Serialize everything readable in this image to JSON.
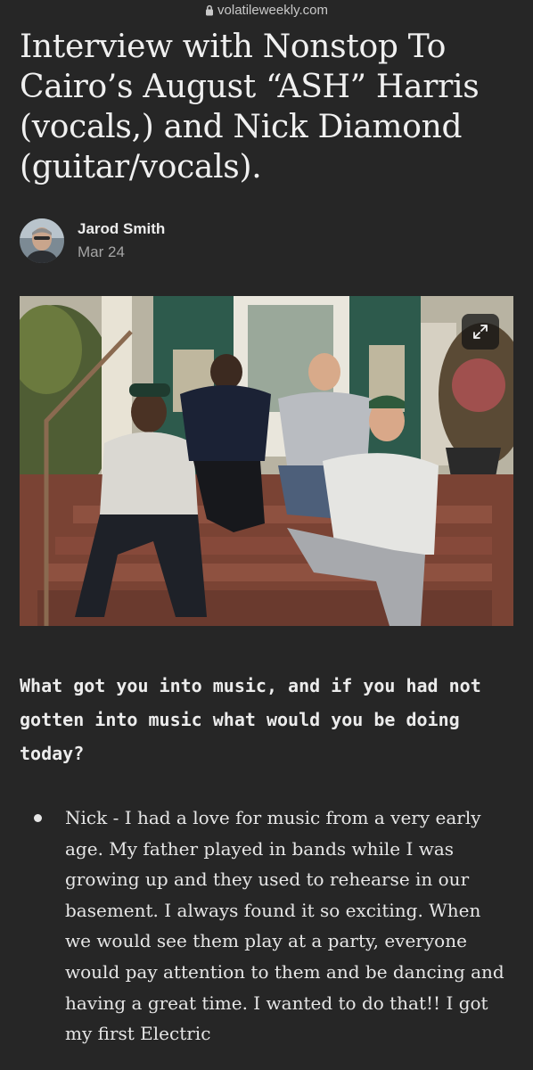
{
  "browser": {
    "url": "volatileweekly.com",
    "lock_icon": "lock-icon"
  },
  "article": {
    "title": "Interview with Nonstop To Cairo’s August “ASH” Harris (vocals,) and Nick Diamond (guitar/vocals).",
    "author": {
      "name": "Jarod Smith",
      "date": "Mar 24"
    },
    "hero_image": {
      "expand_icon": "expand-icon"
    },
    "question": "What got you into music, and if you had not gotten into music what would you be doing today?",
    "answers": [
      {
        "text": "Nick - I had a love for music from a very early age. My father played in bands while I was growing up and they used to rehearse in our basement. I always found it so exciting. When we would see them play at a party, everyone would pay attention to them and be dancing and having a great time. I wanted to do that!! I got my first Electric"
      }
    ]
  },
  "colors": {
    "background": "#262626",
    "text": "#e9e9e9",
    "muted": "#a5a5a5"
  }
}
